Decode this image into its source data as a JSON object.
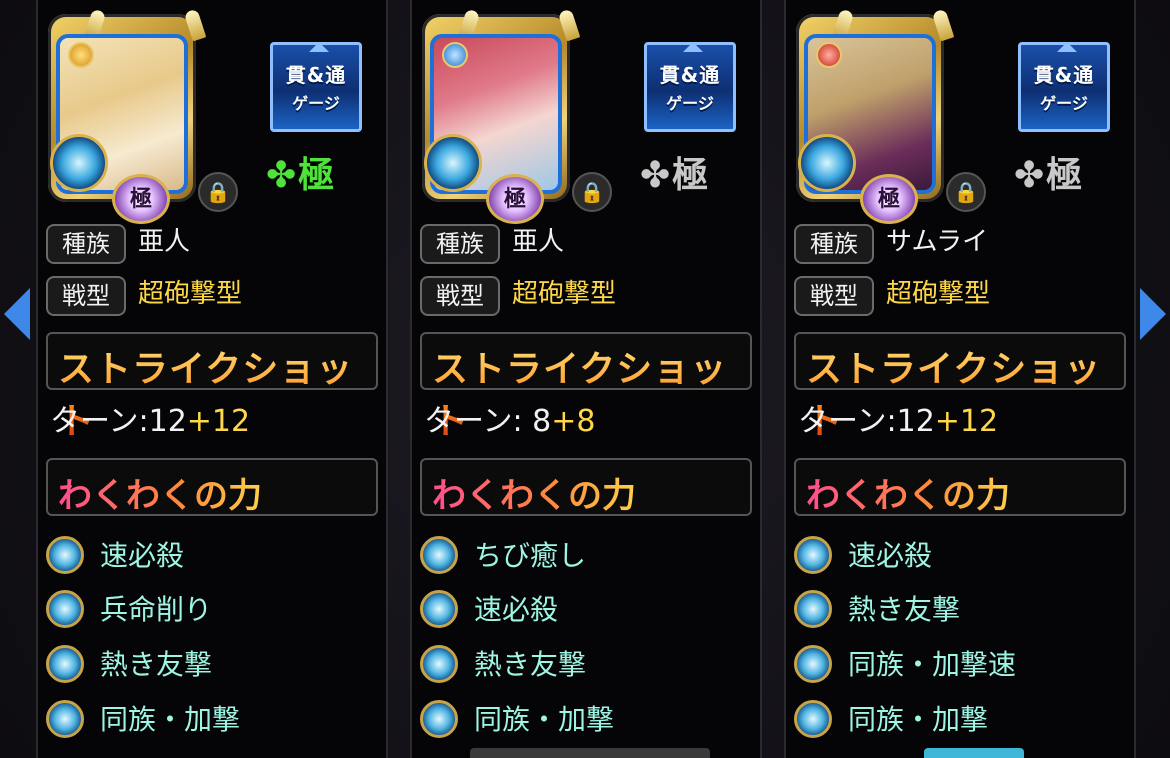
{
  "colors": {
    "accent_blue": "#3d88e8",
    "yellow_value": "#ffd84a",
    "ability_text": "#9ef5e4",
    "kiwami_active": "#4ee23a",
    "kiwami_inactive": "#c8c8c8"
  },
  "cards": [
    {
      "gauge_badge": {
        "line1": "貫&通",
        "line2": "ゲージ"
      },
      "kiwami_badge": "極",
      "kiwami_mark": {
        "icon": "clover-icon",
        "text": "✤極",
        "active": true
      },
      "lock_icon": "lock-icon",
      "tribe_label": "種族",
      "tribe_value": "亜人",
      "type_label": "戦型",
      "type_value": "超砲撃型",
      "strike_shot_title": "ストライクショット",
      "turn_prefix": "ターン:",
      "turn_base": "12",
      "turn_plus": "+12",
      "wakuwaku_title": "わくわくの力",
      "abilities": [
        "速必殺",
        "兵命削り",
        "熱き友撃",
        "同族・加撃"
      ]
    },
    {
      "gauge_badge": {
        "line1": "貫&通",
        "line2": "ゲージ"
      },
      "kiwami_badge": "極",
      "kiwami_mark": {
        "icon": "clover-icon",
        "text": "✤極",
        "active": false
      },
      "lock_icon": "lock-icon",
      "tribe_label": "種族",
      "tribe_value": "亜人",
      "type_label": "戦型",
      "type_value": "超砲撃型",
      "strike_shot_title": "ストライクショット",
      "turn_prefix": "ターン:",
      "turn_base": " 8",
      "turn_plus": "+8",
      "wakuwaku_title": "わくわくの力",
      "abilities": [
        "ちび癒し",
        "速必殺",
        "熱き友撃",
        "同族・加撃"
      ]
    },
    {
      "gauge_badge": {
        "line1": "貫&通",
        "line2": "ゲージ"
      },
      "kiwami_badge": "極",
      "kiwami_mark": {
        "icon": "clover-icon",
        "text": "✤極",
        "active": false
      },
      "lock_icon": "lock-icon",
      "tribe_label": "種族",
      "tribe_value": "サムライ",
      "type_label": "戦型",
      "type_value": "超砲撃型",
      "strike_shot_title": "ストライクショット",
      "turn_prefix": "ターン:",
      "turn_base": "12",
      "turn_plus": "+12",
      "wakuwaku_title": "わくわくの力",
      "abilities": [
        "速必殺",
        "熱き友撃",
        "同族・加撃速",
        "同族・加撃"
      ]
    }
  ]
}
